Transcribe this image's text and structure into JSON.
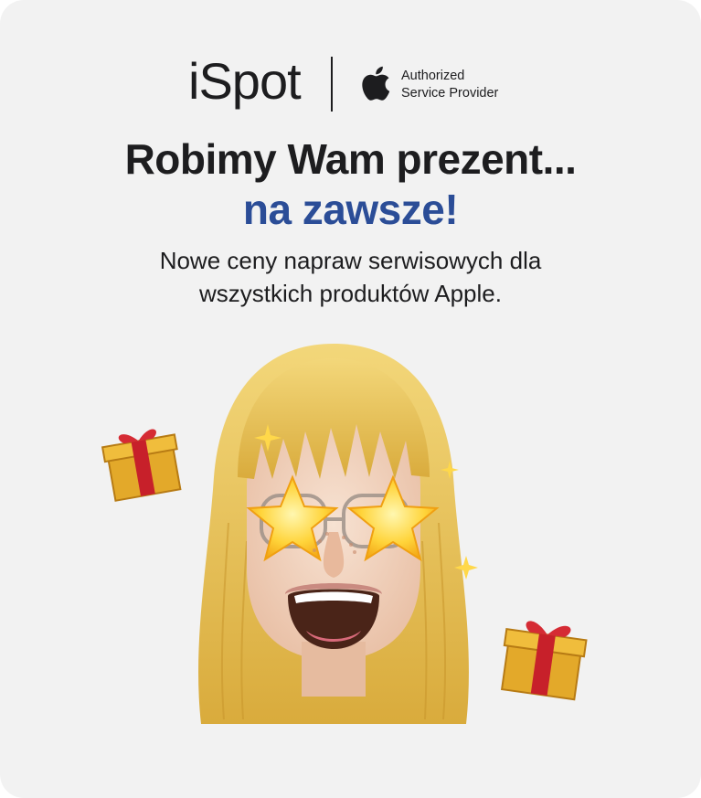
{
  "brand": {
    "name": "iSpot",
    "badge_line1": "Authorized",
    "badge_line2": "Service Provider"
  },
  "headline": {
    "line1": "Robimy Wam prezent...",
    "line2": "na zawsze!"
  },
  "subtitle": {
    "line1": "Nowe ceny napraw serwisowych dla",
    "line2": "wszystkich produktów Apple."
  },
  "colors": {
    "background": "#f2f2f2",
    "text": "#1d1d1f",
    "accent_blue": "#2b4d97",
    "gift_gold": "#e3a92a",
    "ribbon_red": "#c7202a",
    "hair": "#e9c35a"
  },
  "icons": [
    "apple-logo-icon",
    "gift-icon",
    "memoji-illustration",
    "star-eyes-icon"
  ]
}
